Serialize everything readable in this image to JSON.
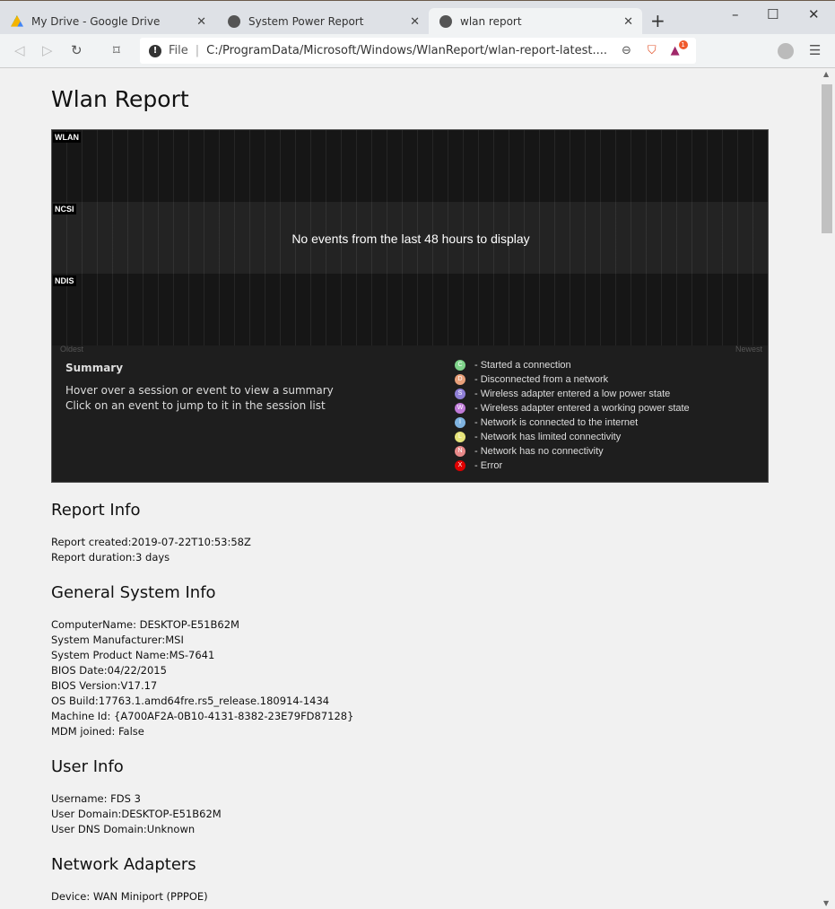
{
  "browser": {
    "tabs": [
      {
        "title": "My Drive - Google Drive",
        "icon": "google-drive-icon"
      },
      {
        "title": "System Power Report",
        "icon": "globe-icon"
      },
      {
        "title": "wlan report",
        "icon": "globe-icon",
        "active": true
      }
    ],
    "address_scheme": "File",
    "address": "C:/ProgramData/Microsoft/Windows/WlanReport/wlan-report-latest....",
    "extension_badge": "1"
  },
  "page": {
    "title": "Wlan Report",
    "timeline": {
      "rows": [
        "WLAN",
        "NCSI",
        "NDIS"
      ],
      "message": "No events from the last 48 hours to display",
      "oldest": "Oldest",
      "newest": "Newest",
      "summary_title": "Summary",
      "summary_lines": [
        "Hover over a session or event to view a summary",
        "Click on an event to jump to it in the session list"
      ],
      "legend": [
        {
          "letter": "C",
          "color": "#7fd38a",
          "text": "- Started a connection"
        },
        {
          "letter": "D",
          "color": "#e8a07a",
          "text": "- Disconnected from a network"
        },
        {
          "letter": "S",
          "color": "#8f7fd6",
          "text": "- Wireless adapter entered a low power state"
        },
        {
          "letter": "W",
          "color": "#c07ad8",
          "text": "- Wireless adapter entered a working power state"
        },
        {
          "letter": "I",
          "color": "#7fb3e0",
          "text": "- Network is connected to the internet"
        },
        {
          "letter": "L",
          "color": "#e6e47a",
          "text": "- Network has limited connectivity"
        },
        {
          "letter": "N",
          "color": "#e88a8a",
          "text": "- Network has no connectivity"
        },
        {
          "letter": "X",
          "color": "#e00000",
          "text": "- Error"
        }
      ]
    },
    "sections": [
      {
        "heading": "Report Info",
        "lines": [
          "Report created:2019-07-22T10:53:58Z",
          "Report duration:3 days"
        ]
      },
      {
        "heading": "General System Info",
        "lines": [
          "ComputerName: DESKTOP-E51B62M",
          "System Manufacturer:MSI",
          "System Product Name:MS-7641",
          "BIOS Date:04/22/2015",
          "BIOS Version:V17.17",
          "OS Build:17763.1.amd64fre.rs5_release.180914-1434",
          "Machine Id: {A700AF2A-0B10-4131-8382-23E79FD87128}",
          "MDM joined: False"
        ]
      },
      {
        "heading": "User Info",
        "lines": [
          "Username: FDS 3",
          "User Domain:DESKTOP-E51B62M",
          "User DNS Domain:Unknown"
        ]
      },
      {
        "heading": "Network Adapters",
        "lines": [
          "Device: WAN Miniport (PPPOE)"
        ]
      }
    ]
  }
}
